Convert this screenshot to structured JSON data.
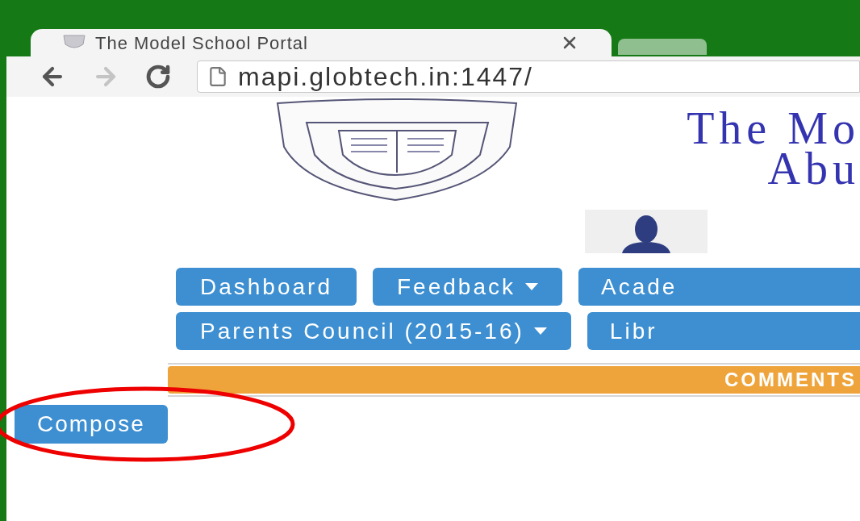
{
  "browser": {
    "tab": {
      "title": "The Model School Portal",
      "selected": true
    },
    "url": "mapi.globtech.in:1447/"
  },
  "header": {
    "title_lines": [
      "The Mo",
      "Abu"
    ]
  },
  "nav_rows": [
    [
      {
        "label": "Dashboard",
        "dropdown": false
      },
      {
        "label": "Feedback",
        "dropdown": true
      },
      {
        "label": "Acade",
        "dropdown": false
      }
    ],
    [
      {
        "label": "Parents Council (2015-16)",
        "dropdown": true
      },
      {
        "label": "Libr",
        "dropdown": false
      }
    ]
  ],
  "section_bar": {
    "label": "COMMENTS"
  },
  "compose_button": "Compose"
}
